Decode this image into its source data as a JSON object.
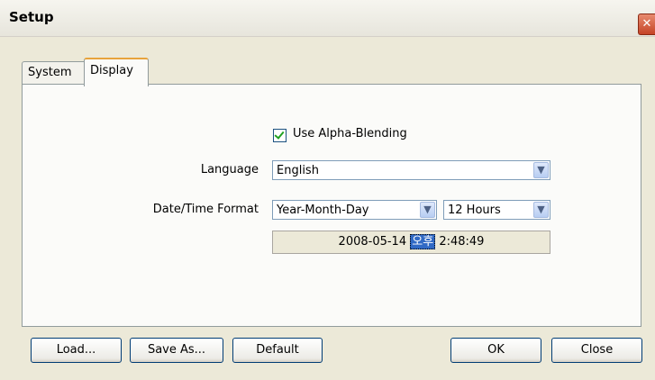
{
  "window": {
    "title": "Setup",
    "close_glyph": "✕"
  },
  "tabs": [
    {
      "label": "System",
      "active": false
    },
    {
      "label": "Display",
      "active": true
    }
  ],
  "display": {
    "alpha_blending": {
      "label": "Use Alpha-Blending",
      "checked": true
    },
    "language": {
      "label": "Language",
      "value": "English"
    },
    "datetime": {
      "label": "Date/Time Format",
      "date_format": "Year-Month-Day",
      "hour_format": "12 Hours",
      "preview_date": "2008-05-14",
      "preview_ampm": "오후",
      "preview_time": "2:48:49"
    }
  },
  "buttons": {
    "load": "Load...",
    "save_as": "Save As...",
    "default": "Default",
    "ok": "OK",
    "close": "Close"
  },
  "icons": {
    "dropdown": "chevron-down-icon",
    "checkbox": "checkmark-icon"
  },
  "colors": {
    "window_bg": "#ece9d8",
    "tab_accent": "#e8a33c",
    "check": "#21a121",
    "highlight": "#316ac5"
  }
}
